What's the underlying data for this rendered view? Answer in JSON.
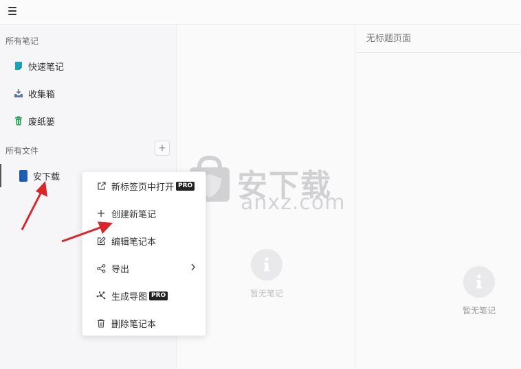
{
  "sidebar": {
    "all_notes_title": "所有笔记",
    "items": [
      {
        "label": "快速笔记",
        "icon": "quick-note-icon",
        "color": "#1ba3b8"
      },
      {
        "label": "收集箱",
        "icon": "inbox-download-icon",
        "color": "#5a78a8"
      },
      {
        "label": "废纸篓",
        "icon": "trash-icon",
        "color": "#27a55a"
      }
    ],
    "all_files_title": "所有文件",
    "add_label": "+",
    "notebook": {
      "label": "安下载",
      "color": "#1e5fb4"
    }
  },
  "context_menu": {
    "items": [
      {
        "label": "新标签页中打开",
        "icon": "external-link-icon",
        "pro": "PRO"
      },
      {
        "label": "创建新笔记",
        "icon": "plus-icon"
      },
      {
        "label": "编辑笔记本",
        "icon": "edit-icon"
      },
      {
        "label": "导出",
        "icon": "share-icon"
      },
      {
        "label": "生成导图",
        "icon": "mindmap-icon",
        "pro": "PRO"
      },
      {
        "label": "删除笔记本",
        "icon": "trash-icon"
      }
    ]
  },
  "middle": {
    "empty_text": "暂无笔记"
  },
  "right": {
    "title": "无标题页面",
    "empty_text": "暂无笔记"
  },
  "watermark": {
    "cn": "安下载",
    "en": "anxz.com"
  }
}
